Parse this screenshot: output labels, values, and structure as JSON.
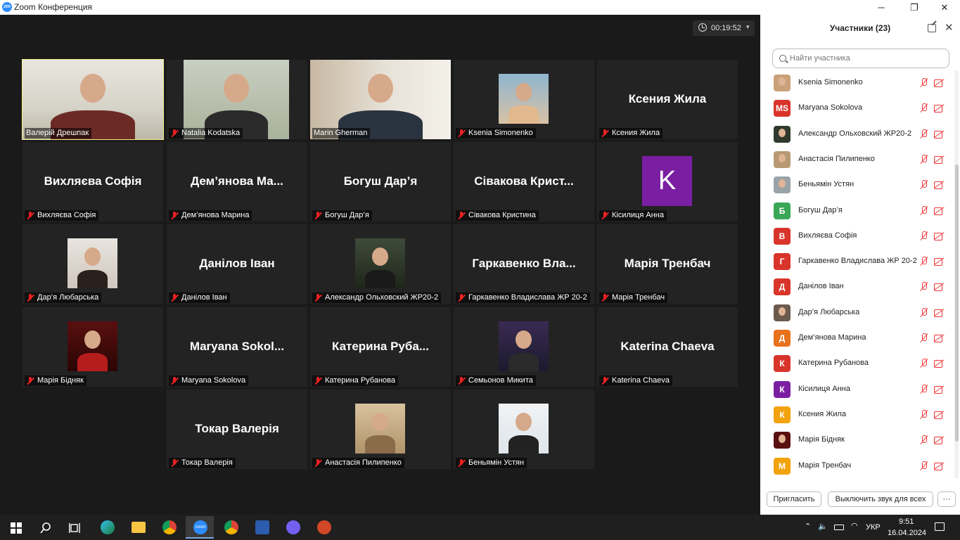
{
  "window": {
    "title": "Zoom Конференция",
    "logo_text": "zm",
    "controls": [
      "─",
      "❐",
      "✕"
    ]
  },
  "meeting": {
    "timer": "00:19:52",
    "timer_caret": "▾"
  },
  "tiles": [
    {
      "label": "Валерій Дрешпак",
      "muted": false,
      "display": "photo",
      "active": true
    },
    {
      "label": "Natalia Kodatska",
      "muted": true,
      "display": "photo"
    },
    {
      "label": "Marin Gherman",
      "muted": false,
      "display": "photo"
    },
    {
      "label": "Ksenia Simonenko",
      "muted": true,
      "display": "photo"
    },
    {
      "label": "Ксения Жила",
      "muted": true,
      "display": "name",
      "big_name": "Ксения Жила"
    },
    {
      "label": "Вихляєва Софія",
      "muted": true,
      "display": "name",
      "big_name": "Вихляєва Софія"
    },
    {
      "label": "Дем’янова Марина",
      "muted": true,
      "display": "name",
      "big_name": "Дем’янова Ма..."
    },
    {
      "label": "Богуш Дар’я",
      "muted": true,
      "display": "name",
      "big_name": "Богуш Дар’я"
    },
    {
      "label": "Сівакова Кристина",
      "muted": true,
      "display": "name",
      "big_name": "Сівакова Крист..."
    },
    {
      "label": "Кісилиця Анна",
      "muted": true,
      "display": "letter",
      "letter": "K"
    },
    {
      "label": "Дар’я Любарська",
      "muted": true,
      "display": "photo"
    },
    {
      "label": "Данілов Іван",
      "muted": true,
      "display": "name",
      "big_name": "Данілов Іван"
    },
    {
      "label": "Александр Ольховский ЖР20-2",
      "muted": true,
      "display": "photo"
    },
    {
      "label": "Гаркавенко Владислава ЖР 20-2",
      "muted": true,
      "display": "name",
      "big_name": "Гаркавенко Вла..."
    },
    {
      "label": "Марія Тренбач",
      "muted": true,
      "display": "name",
      "big_name": "Марія Тренбач"
    },
    {
      "label": "Марія Бідняк",
      "muted": true,
      "display": "photo"
    },
    {
      "label": "Maryana Sokolova",
      "muted": true,
      "display": "name",
      "big_name": "Maryana Sokol..."
    },
    {
      "label": "Катерина Рубанова",
      "muted": true,
      "display": "name",
      "big_name": "Катерина Руба..."
    },
    {
      "label": "Семьонов Микита",
      "muted": true,
      "display": "photo"
    },
    {
      "label": "Katerina Chaeva",
      "muted": true,
      "display": "name",
      "big_name": "Katerina Chaeva"
    },
    {
      "label": "Токар Валерія",
      "muted": true,
      "display": "name",
      "big_name": "Токар Валерія"
    },
    {
      "label": "Анастасія Пилипенко",
      "muted": true,
      "display": "photo"
    },
    {
      "label": "Беньямін Устян",
      "muted": true,
      "display": "photo"
    }
  ],
  "panel": {
    "title": "Участники (23)",
    "close": "✕",
    "search_placeholder": "Найти участника",
    "participants": [
      {
        "name": "Ksenia Simonenko",
        "avatar": "photo",
        "color": "#c9a27a"
      },
      {
        "name": "Maryana Sokolova",
        "avatar": "MS",
        "color": "#d9342b"
      },
      {
        "name": "Александр Ольховский ЖР20-2",
        "avatar": "photo",
        "color": "#2f3a2c"
      },
      {
        "name": "Анастасія Пилипенко",
        "avatar": "photo",
        "color": "#b89a72"
      },
      {
        "name": "Беньямін Устян",
        "avatar": "photo",
        "color": "#9aa3a8"
      },
      {
        "name": "Богуш Дар’я",
        "avatar": "Б",
        "color": "#3aa757"
      },
      {
        "name": "Вихляєва Софія",
        "avatar": "В",
        "color": "#d9342b"
      },
      {
        "name": "Гаркавенко Владислава ЖР 20-2",
        "avatar": "Г",
        "color": "#d9342b"
      },
      {
        "name": "Данілов Іван",
        "avatar": "Д",
        "color": "#d9342b"
      },
      {
        "name": "Дар’я Любарська",
        "avatar": "photo",
        "color": "#6b5a4e"
      },
      {
        "name": "Дем’янова Марина",
        "avatar": "Д",
        "color": "#e8711c"
      },
      {
        "name": "Катерина Рубанова",
        "avatar": "К",
        "color": "#d9342b"
      },
      {
        "name": "Кісилиця Анна",
        "avatar": "К",
        "color": "#7b1fa2"
      },
      {
        "name": "Ксения Жила",
        "avatar": "К",
        "color": "#f2a20c"
      },
      {
        "name": "Марія Бідняк",
        "avatar": "photo",
        "color": "#5a1010"
      },
      {
        "name": "Марія Тренбач",
        "avatar": "М",
        "color": "#f2a20c"
      }
    ],
    "invite_label": "Пригласить",
    "mute_all_label": "Выключить звук для всех",
    "more_label": "···"
  },
  "taskbar": {
    "lang": "УКР",
    "time": "9:51",
    "date": "16.04.2024",
    "zoom_label": "zoom"
  }
}
